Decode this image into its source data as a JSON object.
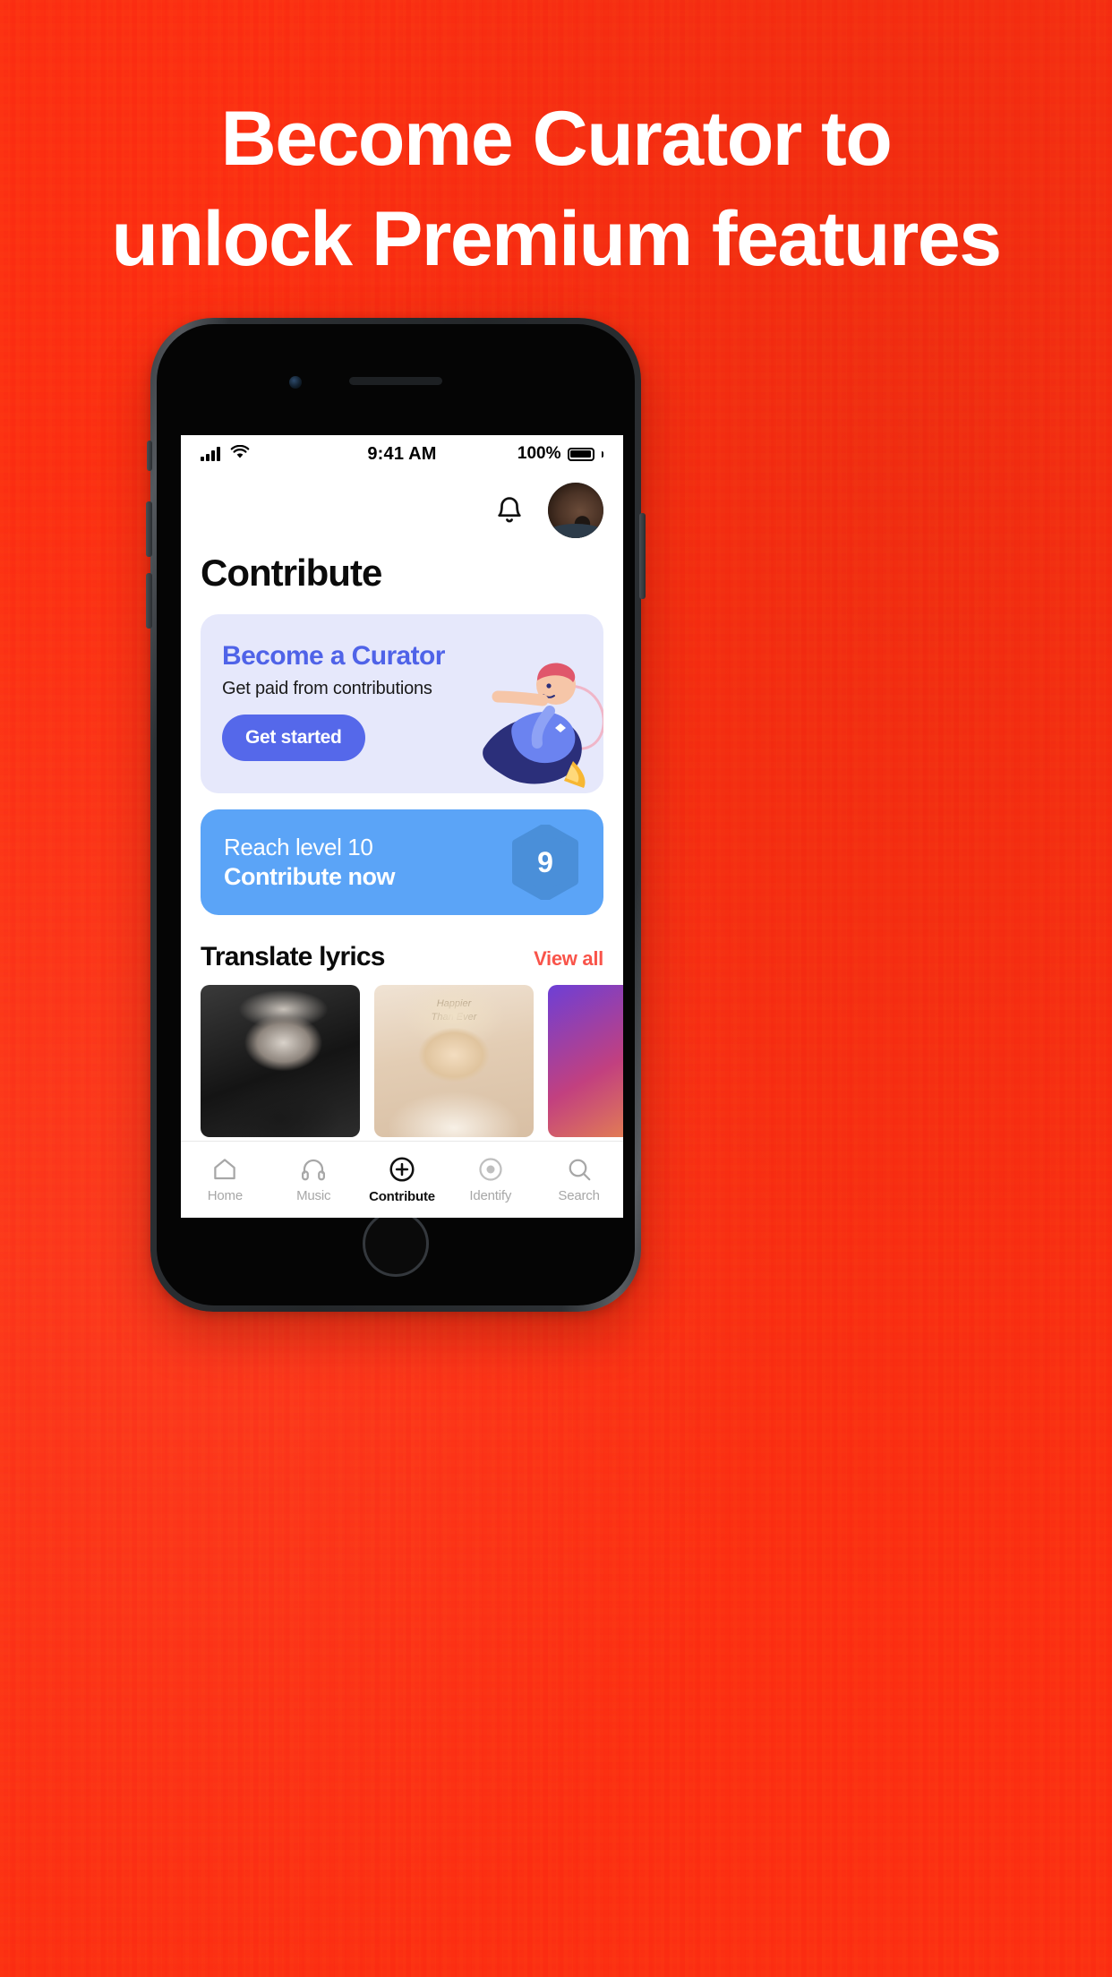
{
  "promo": {
    "headline_line1": "Become Curator to",
    "headline_line2": "unlock Premium features",
    "background_color": "#f9431f",
    "headline_color": "#ffffff"
  },
  "phone": {
    "status_bar": {
      "signal_icon": "cellular-signal-icon",
      "wifi_icon": "wifi-icon",
      "time": "9:41 AM",
      "battery_percent": "100%",
      "battery_icon": "battery-full-icon"
    },
    "app_header": {
      "bell_icon": "bell-icon",
      "avatar_icon": "avatar"
    },
    "page_title": "Contribute",
    "curator_card": {
      "title": "Become a Curator",
      "subtitle": "Get paid from contributions",
      "button_label": "Get started",
      "background_color": "#e6e8fb",
      "title_color": "#4f63e8",
      "button_color": "#5568ea",
      "illustration": "person-riding-rocket-illustration"
    },
    "level_card": {
      "line1": "Reach level 10",
      "line2": "Contribute now",
      "badge_value": "9",
      "background_color": "#5ba4f7",
      "badge_color": "#4a8fd9"
    },
    "translate_section": {
      "title": "Translate lyrics",
      "view_all_label": "View all",
      "view_all_color": "#f9544a",
      "cards": [
        {
          "name": "album-art-drake"
        },
        {
          "name": "album-art-billie-eilish",
          "caption": "Happier\nThan Ever"
        },
        {
          "name": "album-art-gradient"
        }
      ]
    },
    "tab_bar": {
      "tabs": [
        {
          "label": "Home",
          "icon": "home-icon",
          "active": false
        },
        {
          "label": "Music",
          "icon": "headphones-icon",
          "active": false
        },
        {
          "label": "Contribute",
          "icon": "plus-circle-icon",
          "active": true
        },
        {
          "label": "Identify",
          "icon": "record-icon",
          "active": false
        },
        {
          "label": "Search",
          "icon": "search-icon",
          "active": false
        }
      ]
    }
  }
}
